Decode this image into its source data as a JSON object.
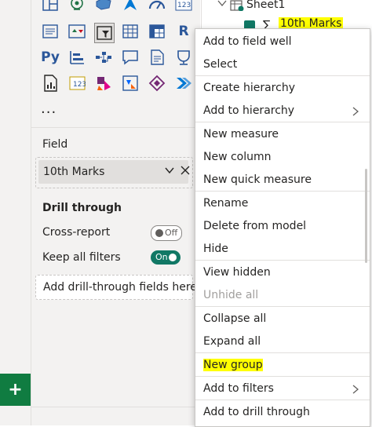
{
  "add_page_label": "+",
  "visualizations": {
    "icons": [
      "treemap-icon",
      "map-icon",
      "shape-map-icon",
      "azure-map-icon",
      "gauge-icon",
      "card-icon",
      "multirow-card-icon",
      "kpi-icon",
      "slicer-icon",
      "table-icon",
      "matrix-icon",
      "r-visual-icon",
      "python-visual-icon",
      "key-influencers-icon",
      "decomposition-tree-icon",
      "qa-icon",
      "narrative-icon",
      "paginated-report-icon",
      "report-icon",
      "metrics-icon",
      "power-apps-icon",
      "power-automate-icon",
      "diamond-visual-icon",
      "more-chevrons-icon"
    ],
    "more_label": "..."
  },
  "field_section": {
    "label": "Field",
    "chip_value": "10th Marks"
  },
  "drill_through": {
    "title": "Drill through",
    "cross_report_label": "Cross-report",
    "cross_report_toggle": "Off",
    "keep_filters_label": "Keep all filters",
    "keep_filters_toggle": "On",
    "add_fields_label": "Add drill-through fields here"
  },
  "fields_tree": {
    "table_name": "Sheet1",
    "selected_field_symbol": "∑",
    "selected_field": "10th Marks"
  },
  "context_menu": {
    "items": [
      {
        "label": "Add to field well",
        "disabled": false
      },
      {
        "label": "Select",
        "disabled": false
      },
      {
        "label": "Create hierarchy",
        "disabled": false
      },
      {
        "label": "Add to hierarchy",
        "disabled": false,
        "submenu": true
      },
      {
        "label": "New measure",
        "disabled": false
      },
      {
        "label": "New column",
        "disabled": false
      },
      {
        "label": "New quick measure",
        "disabled": false
      },
      {
        "label": "Rename",
        "disabled": false
      },
      {
        "label": "Delete from model",
        "disabled": false
      },
      {
        "label": "Hide",
        "disabled": false
      },
      {
        "label": "View hidden",
        "disabled": false
      },
      {
        "label": "Unhide all",
        "disabled": true
      },
      {
        "label": "Collapse all",
        "disabled": false
      },
      {
        "label": "Expand all",
        "disabled": false
      },
      {
        "label": "New group",
        "disabled": false,
        "highlighted": true
      },
      {
        "label": "Add to filters",
        "disabled": false,
        "submenu": true
      },
      {
        "label": "Add to drill through",
        "disabled": false
      }
    ]
  },
  "colors": {
    "accent_green": "#117865",
    "highlight_yellow": "#ffff00",
    "add_page_green": "#107c41"
  }
}
